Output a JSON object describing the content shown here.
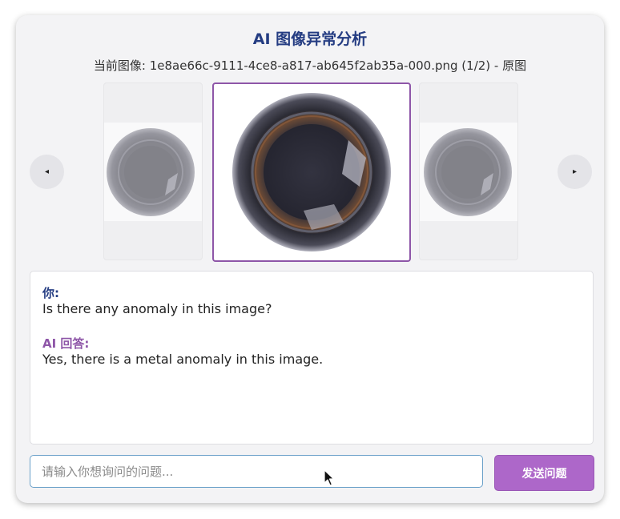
{
  "header": {
    "title": "AI 图像异常分析",
    "subtitle": "当前图像: 1e8ae66c-9111-4ce8-a817-ab645f2ab35a-000.png (1/2) - 原图"
  },
  "carousel": {
    "prev_icon": "◂",
    "next_icon": "▸"
  },
  "chat": {
    "user_label": "你:",
    "user_message": "Is there any anomaly in this image?",
    "ai_label": "AI 回答:",
    "ai_message": "Yes, there is a metal anomaly in this image."
  },
  "composer": {
    "placeholder": "请输入你想询问的问题...",
    "value": "",
    "send_label": "发送问题"
  },
  "colors": {
    "title": "#243c82",
    "accent": "#8e56a8",
    "send_button": "#ad67c9",
    "input_border": "#6aa0c9"
  }
}
